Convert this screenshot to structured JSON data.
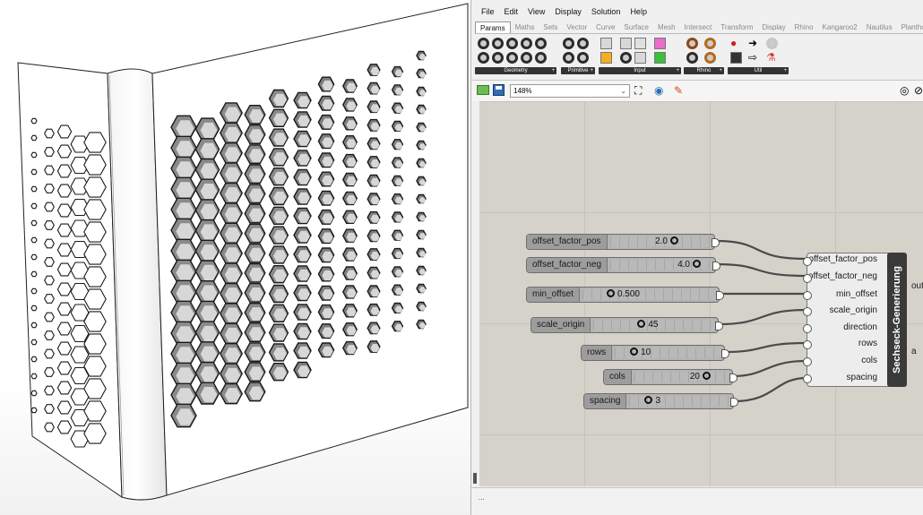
{
  "menu": [
    "File",
    "Edit",
    "View",
    "Display",
    "Solution",
    "Help"
  ],
  "tabs": [
    "Params",
    "Maths",
    "Sets",
    "Vector",
    "Curve",
    "Surface",
    "Mesh",
    "Intersect",
    "Transform",
    "Display",
    "Rhino",
    "Kangaroo2",
    "Nautilus",
    "Planthopp"
  ],
  "ribbon_groups": [
    {
      "label": "Geometry",
      "icons": [
        "circle-icon",
        "disc-icon",
        "curve-icon",
        "brep-icon",
        "mesh-icon",
        "box-icon",
        "plane-icon",
        "point-icon",
        "surface-icon",
        "line-icon",
        "field-icon",
        "group-icon"
      ]
    },
    {
      "label": "Primitive",
      "icons": [
        "number-icon",
        "integer-icon",
        "complex-icon",
        "text-icon"
      ]
    },
    {
      "label": "Input",
      "icons": [
        "slider-icon",
        "panel-icon",
        "swatch-icon",
        "gradient-icon",
        "toggle-icon",
        "button-icon",
        "graph-icon",
        "file-icon"
      ]
    },
    {
      "label": "Rhino",
      "icons": [
        "rhino-object-icon",
        "rhino-pattern-icon",
        "rhino-layer-icon",
        "rhino-material-icon"
      ]
    },
    {
      "label": "Util",
      "icons": [
        "cherry-icon",
        "jump-icon",
        "relay-icon",
        "cluster-icon",
        "arrow-icon",
        "flask-icon"
      ]
    }
  ],
  "toolbar": {
    "zoom": "148%"
  },
  "sliders": [
    {
      "name": "offset_factor_pos",
      "value": "2.0"
    },
    {
      "name": "offset_factor_neg",
      "value": "4.0"
    },
    {
      "name": "min_offset",
      "value": "0.500"
    },
    {
      "name": "scale_origin",
      "value": "45"
    },
    {
      "name": "rows",
      "value": "10"
    },
    {
      "name": "cols",
      "value": "20"
    },
    {
      "name": "spacing",
      "value": "3"
    }
  ],
  "cluster": {
    "title": "Sechseck-Generierung",
    "inputs": [
      "offset_factor_pos",
      "offset_factor_neg",
      "min_offset",
      "scale_origin",
      "direction",
      "rows",
      "cols",
      "spacing"
    ],
    "outputs": [
      "out",
      "a"
    ]
  },
  "status": "..."
}
